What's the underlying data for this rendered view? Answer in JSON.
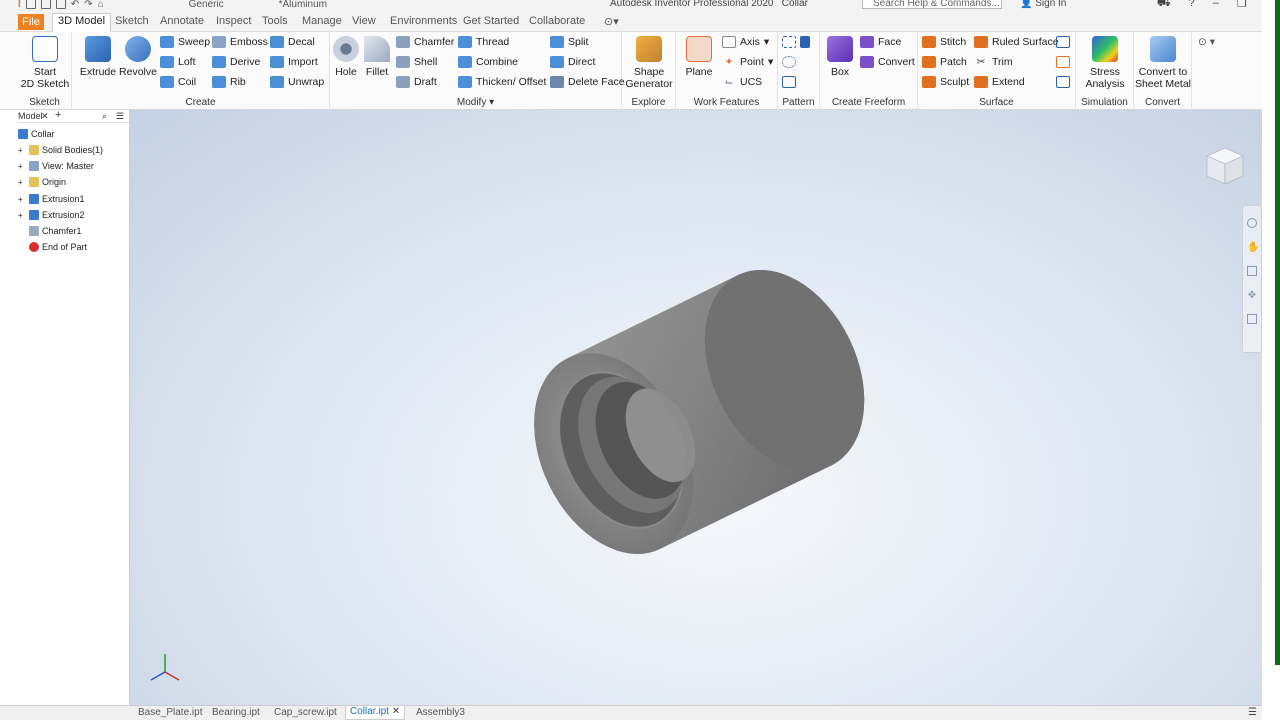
{
  "app": {
    "title": "Autodesk Inventor Professional 2020",
    "document": "Collar",
    "search_placeholder": "Search Help & Commands...",
    "sign_in": "Sign In",
    "appearance": "Generic",
    "material": "*Aluminum"
  },
  "tabs": [
    "File",
    "3D Model",
    "Sketch",
    "Annotate",
    "Inspect",
    "Tools",
    "Manage",
    "View",
    "Environments",
    "Get Started",
    "Collaborate"
  ],
  "ribbon": {
    "sketch": {
      "start_label": "Start",
      "start_label2": "2D Sketch",
      "group": "Sketch"
    },
    "create": {
      "extrude": "Extrude",
      "revolve": "Revolve",
      "sweep": "Sweep",
      "loft": "Loft",
      "coil": "Coil",
      "emboss": "Emboss",
      "derive": "Derive",
      "rib": "Rib",
      "decal": "Decal",
      "import": "Import",
      "unwrap": "Unwrap",
      "group": "Create"
    },
    "modify": {
      "hole": "Hole",
      "fillet": "Fillet",
      "chamfer": "Chamfer",
      "shell": "Shell",
      "draft": "Draft",
      "thread": "Thread",
      "combine": "Combine",
      "thicken": "Thicken/ Offset",
      "split": "Split",
      "direct": "Direct",
      "delete_face": "Delete Face",
      "group": "Modify"
    },
    "explore": {
      "shape": "Shape",
      "shape2": "Generator",
      "group": "Explore"
    },
    "work": {
      "plane": "Plane",
      "axis": "Axis",
      "point": "Point",
      "ucs": "UCS",
      "group": "Work Features"
    },
    "pattern": {
      "group": "Pattern"
    },
    "freeform": {
      "box": "Box",
      "face": "Face",
      "convert": "Convert",
      "group": "Create Freeform"
    },
    "surface": {
      "stitch": "Stitch",
      "patch": "Patch",
      "sculpt": "Sculpt",
      "ruled": "Ruled Surface",
      "trim": "Trim",
      "extend": "Extend",
      "group": "Surface"
    },
    "simulation": {
      "stress": "Stress",
      "stress2": "Analysis",
      "group": "Simulation"
    },
    "convert": {
      "sheet": "Convert to",
      "sheet2": "Sheet Metal",
      "group": "Convert"
    }
  },
  "browser": {
    "tab": "Model",
    "items": [
      {
        "label": "Collar"
      },
      {
        "label": "Solid Bodies(1)"
      },
      {
        "label": "View: Master"
      },
      {
        "label": "Origin"
      },
      {
        "label": "Extrusion1"
      },
      {
        "label": "Extrusion2"
      },
      {
        "label": "Chamfer1"
      },
      {
        "label": "End of Part"
      }
    ]
  },
  "doc_tabs": [
    "Base_Plate.ipt",
    "Bearing.ipt",
    "Cap_screw.ipt",
    "Collar.ipt",
    "Assembly3"
  ],
  "colors": {
    "file_tab": "#f08020",
    "active_doc": "#1a6bc2",
    "green_bar": "#146b14"
  }
}
